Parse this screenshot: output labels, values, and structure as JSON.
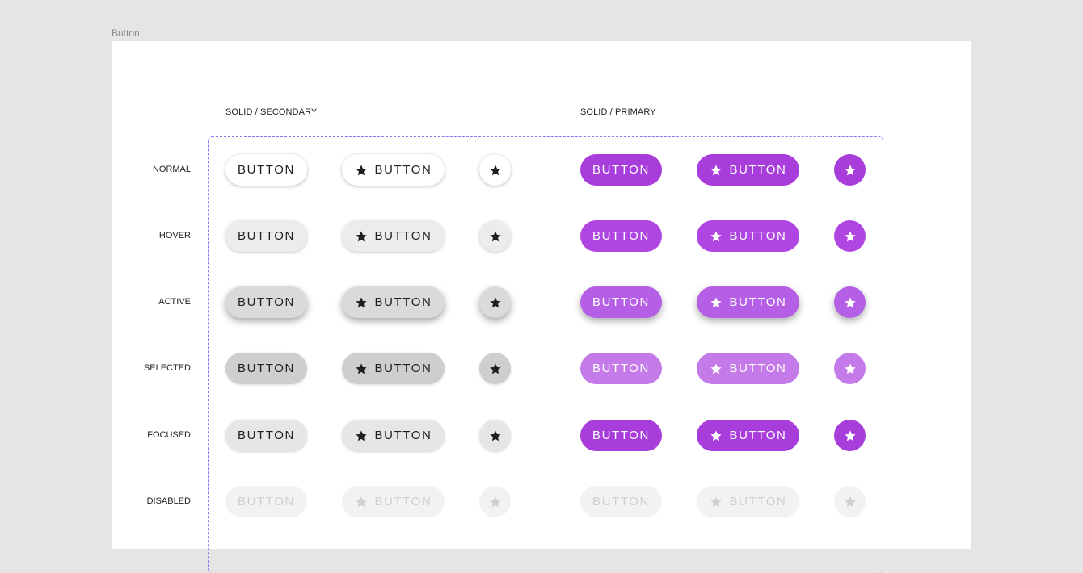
{
  "frame_title": "Button",
  "groups": {
    "secondary_label": "SOLID / SECONDARY",
    "primary_label": "SOLID / PRIMARY"
  },
  "states": {
    "normal": "NORMAL",
    "hover": "HOVER",
    "active": "ACTIVE",
    "selected": "SELECTED",
    "focused": "FOCUSED",
    "disabled": "DISABLED"
  },
  "button_label": "BUTTON",
  "icon": "star-icon",
  "colors": {
    "primary": "#a83ddc",
    "dashed_outline": "#8f74ee",
    "secondary_text": "#1f1f1f"
  }
}
